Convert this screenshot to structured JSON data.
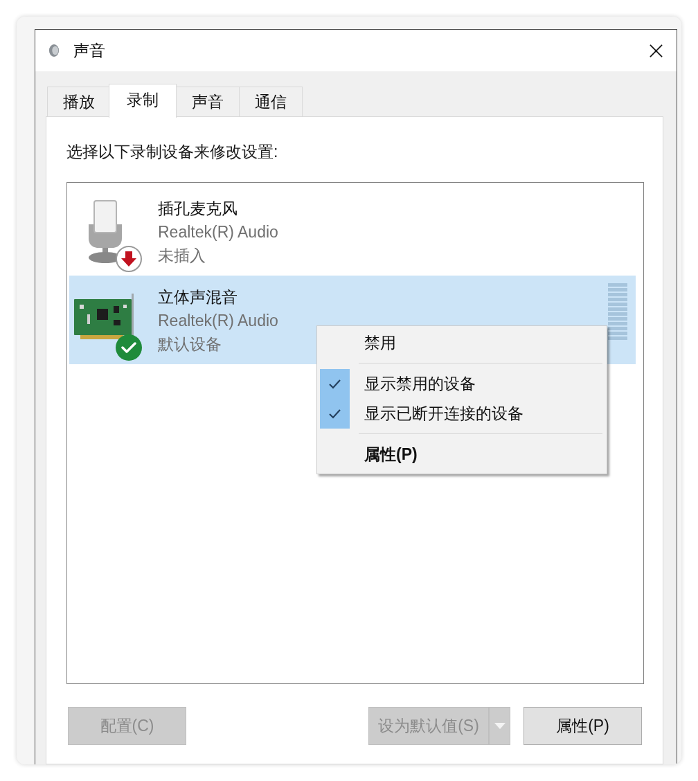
{
  "window": {
    "title": "声音"
  },
  "tabs": [
    {
      "label": "播放",
      "selected": false
    },
    {
      "label": "录制",
      "selected": true
    },
    {
      "label": "声音",
      "selected": false
    },
    {
      "label": "通信",
      "selected": false
    }
  ],
  "instruction": "选择以下录制设备来修改设置:",
  "devices": [
    {
      "kind": "microphone",
      "badge": {
        "kind": "unplugged"
      },
      "name": "插孔麦克风",
      "driver": "Realtek(R) Audio",
      "status": "未插入",
      "selected": false
    },
    {
      "kind": "sound-card",
      "badge": {
        "kind": "default"
      },
      "name": "立体声混音",
      "driver": "Realtek(R) Audio",
      "status": "默认设备",
      "selected": true,
      "meter": {
        "level": 0
      }
    }
  ],
  "context_menu": {
    "groups": [
      {
        "items": [
          {
            "label": "禁用",
            "checked": false,
            "default": false
          }
        ]
      },
      {
        "items": [
          {
            "label": "显示禁用的设备",
            "checked": true,
            "default": false
          },
          {
            "label": "显示已断开连接的设备",
            "checked": true,
            "default": false
          }
        ]
      },
      {
        "items": [
          {
            "label": "属性(P)",
            "checked": false,
            "default": true
          }
        ]
      }
    ]
  },
  "buttons": [
    {
      "kind": "push",
      "label": "配置(C)",
      "disabled": true
    },
    {
      "kind": "split",
      "label": "设为默认值(S)",
      "disabled": true
    },
    {
      "kind": "push",
      "label": "属性(P)",
      "disabled": false
    }
  ]
}
